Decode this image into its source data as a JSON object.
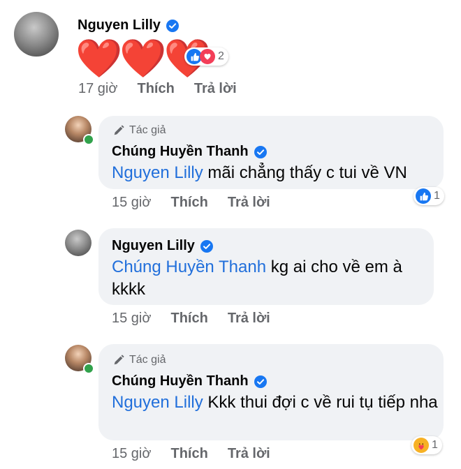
{
  "comments": [
    {
      "author": "Nguyen Lilly",
      "verified": true,
      "content": "❤️❤️❤️",
      "reactions": {
        "icons": [
          "like-icon",
          "love-icon"
        ],
        "count": "2"
      },
      "time": "17 giờ",
      "like_label": "Thích",
      "reply_label": "Trả lời"
    },
    {
      "author_tag": "Tác giả",
      "author": "Chúng Huyền Thanh",
      "verified": true,
      "mention": "Nguyen Lilly",
      "content": " mãi chẳng thấy c tui về VN",
      "reactions": {
        "icons": [
          "like-icon"
        ],
        "count": "1"
      },
      "time": "15 giờ",
      "like_label": "Thích",
      "reply_label": "Trả lời"
    },
    {
      "author": "Nguyen Lilly",
      "verified": true,
      "mention": "Chúng Huyền Thanh",
      "content": " kg ai cho về em à kkkk",
      "time": "15 giờ",
      "like_label": "Thích",
      "reply_label": "Trả lời"
    },
    {
      "author_tag": "Tác giả",
      "author": "Chúng Huyền Thanh",
      "verified": true,
      "mention": "Nguyen Lilly",
      "content": " Kkk thui đợi c về rui tụ tiếp nha",
      "reactions": {
        "icons": [
          "care-icon"
        ],
        "count": "1"
      },
      "time": "15 giờ",
      "like_label": "Thích",
      "reply_label": "Trả lời"
    }
  ],
  "colors": {
    "bubble": "#f0f2f5",
    "mention": "#216fdb",
    "meta": "#65676b",
    "verified": "#1877f2",
    "love": "#f33e58",
    "online": "#31a24c"
  }
}
